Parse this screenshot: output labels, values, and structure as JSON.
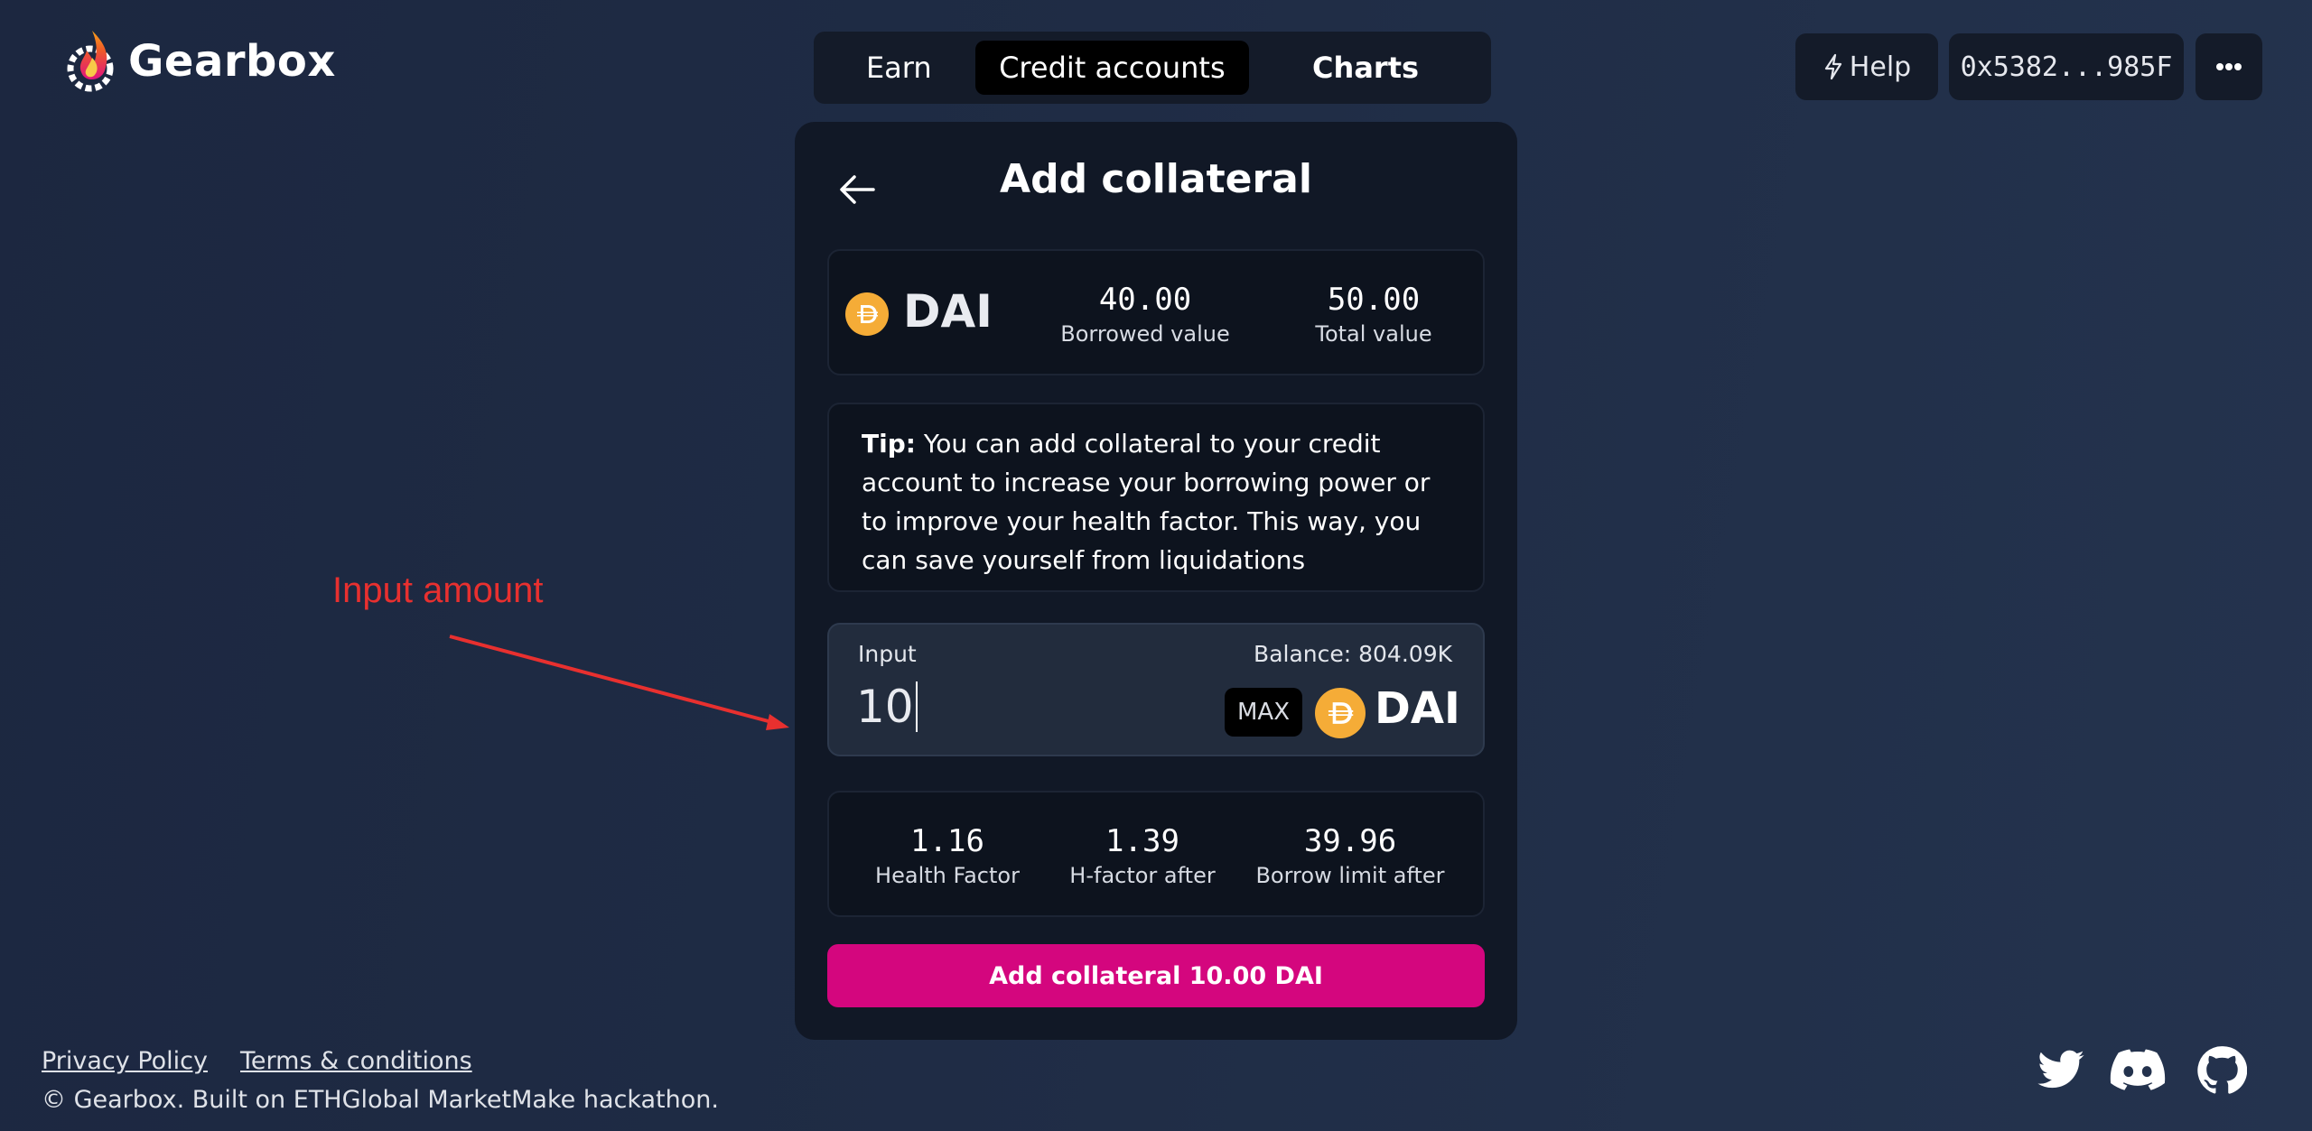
{
  "brand": {
    "name": "Gearbox"
  },
  "nav": {
    "tabs": [
      "Earn",
      "Credit accounts",
      "Charts"
    ],
    "active": "Credit accounts"
  },
  "header": {
    "help_label": "Help",
    "wallet_address": "0x5382...985F"
  },
  "card": {
    "title": "Add collateral",
    "token": {
      "symbol": "DAI",
      "borrowed_value": "40.00",
      "borrowed_label": "Borrowed value",
      "total_value": "50.00",
      "total_label": "Total value"
    },
    "tip": {
      "label": "Tip:",
      "text": " You can add collateral to your credit account to increase your borrowing power or to improve your health factor. This way, you can save yourself from liquidations"
    },
    "input": {
      "label": "Input",
      "balance": "Balance: 804.09K",
      "value": "10",
      "max_label": "MAX",
      "token": "DAI"
    },
    "factors": [
      {
        "value": "1.16",
        "label": "Health Factor"
      },
      {
        "value": "1.39",
        "label": "H-factor after"
      },
      {
        "value": "39.96",
        "label": "Borrow limit after"
      }
    ],
    "submit_label": "Add collateral 10.00 DAI"
  },
  "annotation": {
    "text": "Input amount",
    "color": "#e8302f"
  },
  "footer": {
    "links": [
      "Privacy Policy",
      "Terms & conditions"
    ],
    "copyright": "© Gearbox. Built on ETHGlobal MarketMake hackathon.",
    "socials": [
      "twitter-icon",
      "discord-icon",
      "github-icon"
    ]
  },
  "colors": {
    "accent": "#d4067e",
    "dai": "#f5ac37",
    "background": "#1f2c45",
    "card": "#111826"
  }
}
